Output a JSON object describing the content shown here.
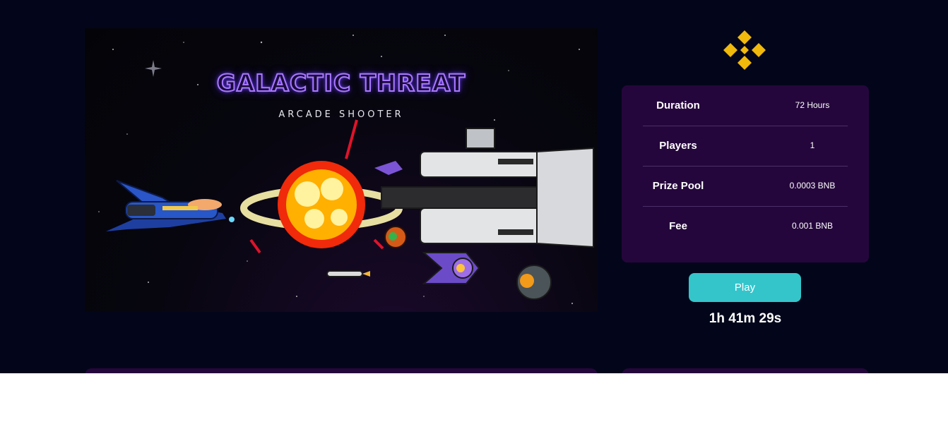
{
  "game": {
    "title": "GALACTIC THREAT",
    "subtitle": "ARCADE SHOOTER"
  },
  "logo": {
    "icon": "binance-icon",
    "color": "#f0b90b"
  },
  "info": {
    "rows": [
      {
        "label": "Duration",
        "value": "72 Hours"
      },
      {
        "label": "Players",
        "value": "1"
      },
      {
        "label": "Prize Pool",
        "value": "0.0003 BNB"
      },
      {
        "label": "Fee",
        "value": "0.001 BNB"
      }
    ]
  },
  "actions": {
    "play_label": "Play"
  },
  "timer": {
    "countdown": "1h 41m 29s"
  },
  "colors": {
    "background": "#03061a",
    "card": "#25063c",
    "accent": "#34c5cb",
    "brand": "#f0b90b"
  }
}
